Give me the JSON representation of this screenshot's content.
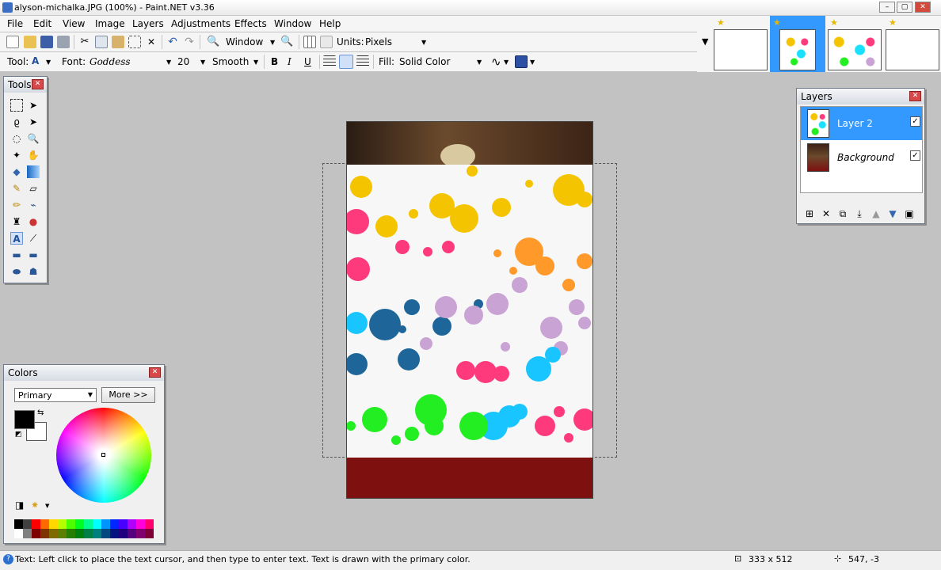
{
  "window": {
    "title": "alyson-michalka.JPG (100%) - Paint.NET v3.36",
    "min": "–",
    "max": "▢",
    "close": "✕"
  },
  "menu": [
    "File",
    "Edit",
    "View",
    "Image",
    "Layers",
    "Adjustments",
    "Effects",
    "Window",
    "Help"
  ],
  "toolbar": {
    "window_label": "Window",
    "units_label": "Units:",
    "units_value": "Pixels"
  },
  "toolbar2": {
    "tool_label": "Tool:",
    "tool_value": "A",
    "font_label": "Font:",
    "font_value": "Goddess",
    "size_value": "20",
    "smooth_value": "Smooth",
    "bold": "B",
    "italic": "I",
    "underline": "U",
    "fill_label": "Fill:",
    "fill_value": "Solid Color"
  },
  "tools": {
    "title": "Tools",
    "close": "✕"
  },
  "layers": {
    "title": "Layers",
    "close": "✕",
    "items": [
      {
        "name": "Layer 2",
        "checked": "✓"
      },
      {
        "name": "Background",
        "checked": "✓"
      }
    ]
  },
  "colors": {
    "title": "Colors",
    "close": "✕",
    "primary_select": "Primary",
    "more_button": "More >>"
  },
  "status": {
    "message": "Text: Left click to place the text cursor, and then type to enter text. Text is drawn with the primary color.",
    "size": "333 x 512",
    "coords": "547, -3"
  },
  "colors_theme": {
    "accent": "#3399ff",
    "selected_layer": "#3399ff"
  }
}
